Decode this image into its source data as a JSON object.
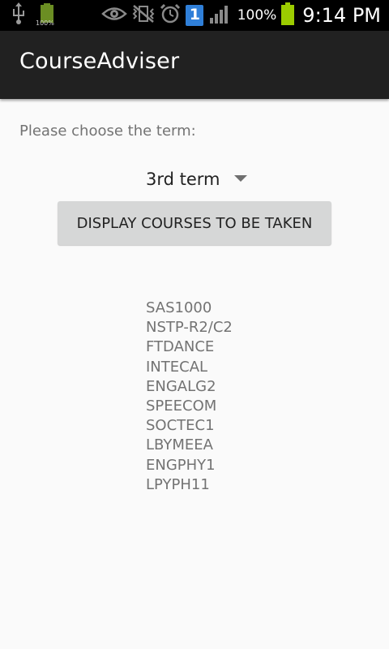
{
  "status_bar": {
    "notification_icons": [
      "usb-icon",
      "battery-app-icon"
    ],
    "battery_app_label": "100%",
    "system_icons": [
      "eye-icon",
      "vibrate-off-icon",
      "alarm-icon",
      "sim-1-icon",
      "signal-icon",
      "battery-icon"
    ],
    "sim_label": "1",
    "battery_percent": "100%",
    "battery_level": 1.0,
    "time": "9:14 PM"
  },
  "action_bar": {
    "title": "CourseAdviser"
  },
  "main": {
    "prompt": "Please choose the term:",
    "term_spinner": {
      "selected": "3rd term"
    },
    "display_button_label": "DISPLAY COURSES TO BE TAKEN",
    "courses": [
      "SAS1000",
      "NSTP-R2/C2",
      "FTDANCE",
      "INTECAL",
      "ENGALG2",
      "SPEECOM",
      "SOCTEC1",
      "LBYMEEA",
      "ENGPHY1",
      "LPYPH11"
    ]
  },
  "colors": {
    "status_bar_bg": "#000000",
    "action_bar_bg": "#212121",
    "page_bg": "#fafafa",
    "button_bg": "#d6d7d7",
    "battery_green": "#9ccc00"
  }
}
